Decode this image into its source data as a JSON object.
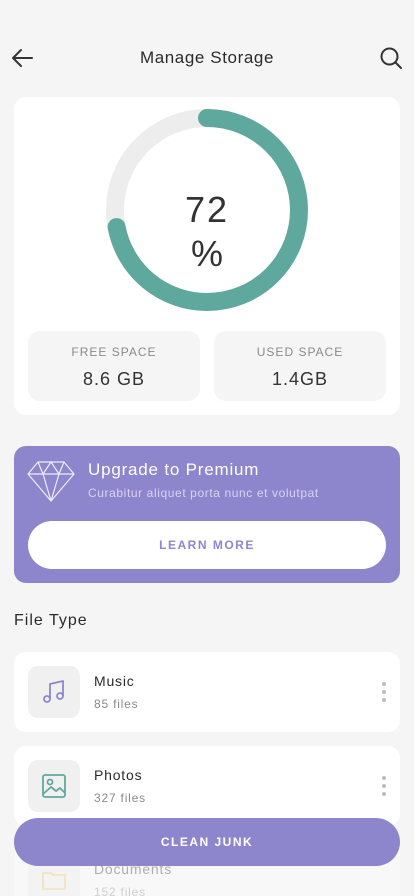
{
  "header": {
    "title": "Manage Storage",
    "back_icon": "arrow-left-icon",
    "search_icon": "search-icon"
  },
  "storage": {
    "used_percent": 72,
    "percent_number": "72",
    "percent_symbol": "%",
    "colors": {
      "used": "#5fa89e",
      "track": "#ededed"
    },
    "free": {
      "label": "FREE SPACE",
      "value": "8.6 GB"
    },
    "used": {
      "label": "USED SPACE",
      "value": "1.4GB"
    }
  },
  "premium": {
    "icon": "diamond-icon",
    "title": "Upgrade to Premium",
    "subtitle": "Curabitur aliquet porta nunc et volutpat",
    "button_label": "LEARN MORE",
    "color": "#8e86cc"
  },
  "file_type": {
    "title": "File Type",
    "items": [
      {
        "name": "Music",
        "count": "85 files",
        "icon": "music-note-icon",
        "icon_color": "#8e86cc"
      },
      {
        "name": "Photos",
        "count": "327 files",
        "icon": "image-icon",
        "icon_color": "#5fa89e"
      },
      {
        "name": "Documents",
        "count": "152 files",
        "icon": "folder-icon",
        "icon_color": "#f2c26b"
      }
    ]
  },
  "clean_junk": {
    "label": "CLEAN JUNK"
  }
}
